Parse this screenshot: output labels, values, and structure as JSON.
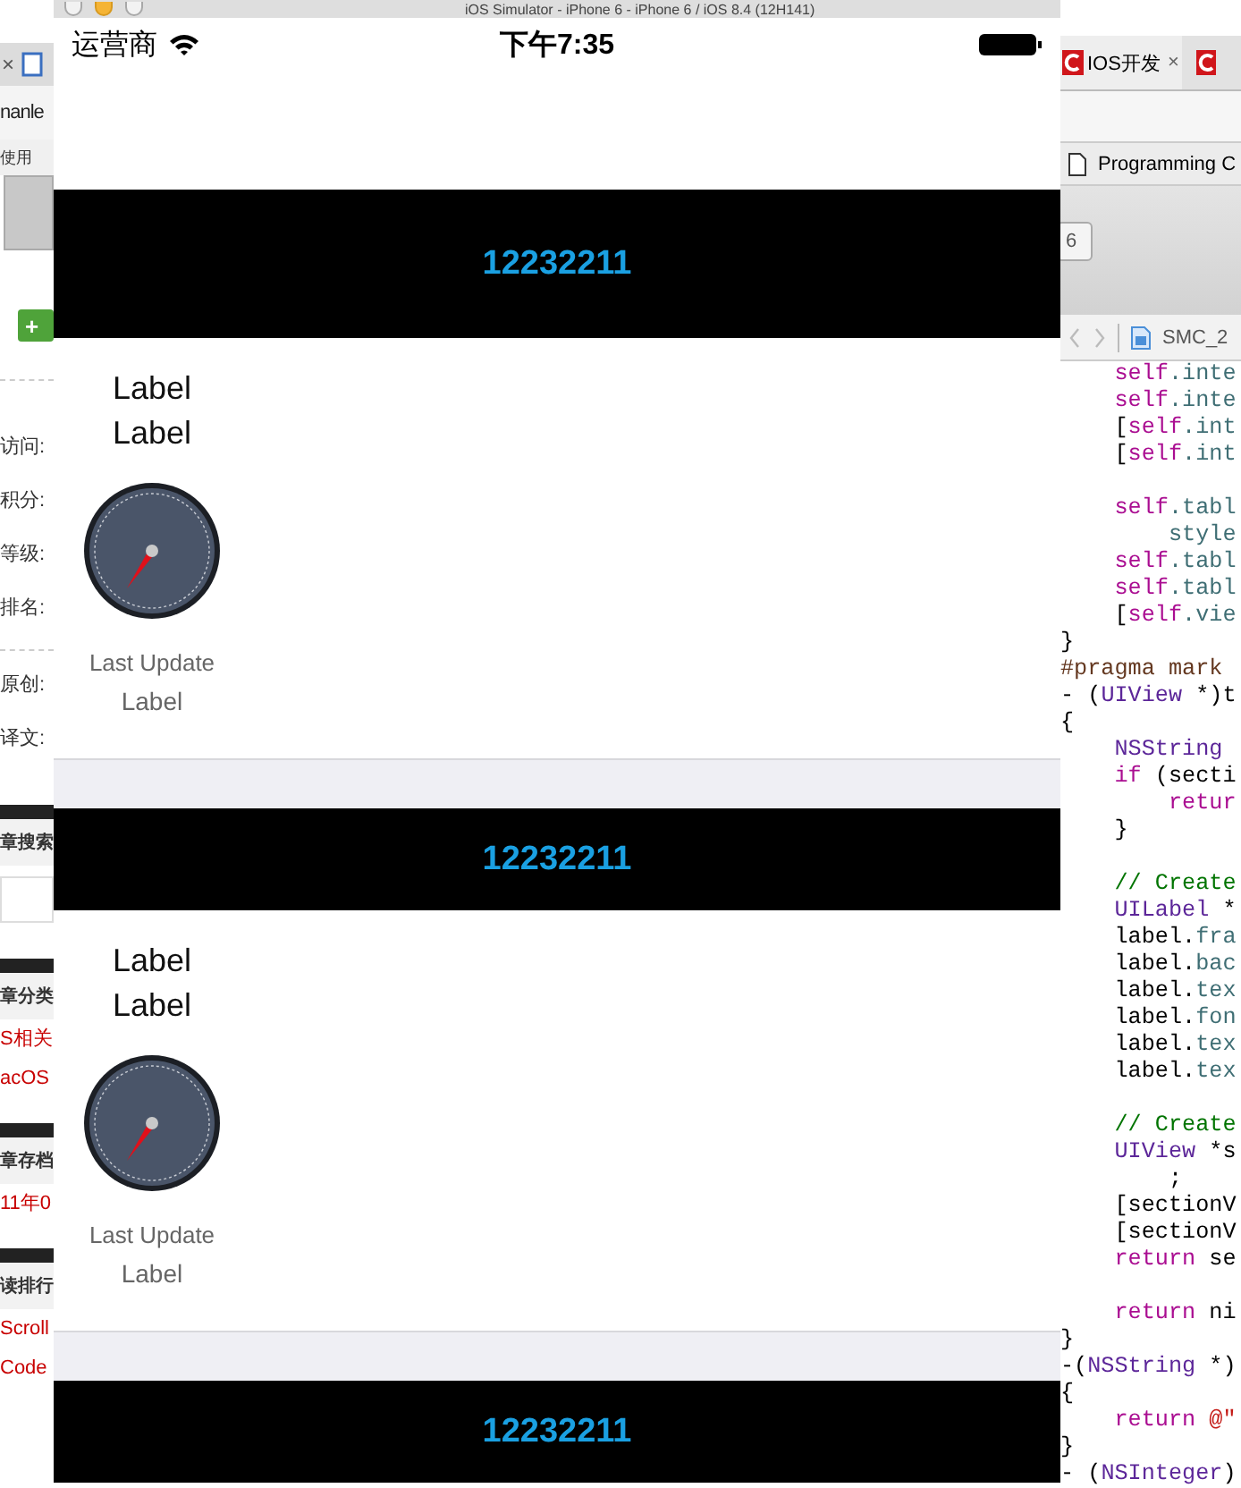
{
  "left_window": {
    "tab_close": "×",
    "address": "nanle",
    "bookmark": "使用",
    "add_button": "+",
    "items": [
      {
        "kind": "stat",
        "text": "访问:"
      },
      {
        "kind": "stat",
        "text": "积分:"
      },
      {
        "kind": "stat",
        "text": "等级:"
      },
      {
        "kind": "stat",
        "text": "排名:"
      },
      {
        "kind": "rule"
      },
      {
        "kind": "stat",
        "text": "原创:"
      },
      {
        "kind": "stat",
        "text": "译文:"
      },
      {
        "kind": "heading",
        "text": "章搜索"
      },
      {
        "kind": "blank"
      },
      {
        "kind": "heading",
        "text": "章分类"
      },
      {
        "kind": "link",
        "text": "S相关"
      },
      {
        "kind": "link",
        "text": "acOS"
      },
      {
        "kind": "heading",
        "text": "章存档"
      },
      {
        "kind": "link",
        "text": "11年0"
      },
      {
        "kind": "heading",
        "text": "读排行"
      },
      {
        "kind": "link",
        "text": "Scroll"
      },
      {
        "kind": "link",
        "text": "Code"
      }
    ]
  },
  "simulator": {
    "title": "iOS Simulator - iPhone 6 - iPhone 6 / iOS 8.4 (12H141)",
    "status_bar": {
      "carrier": "运营商",
      "time": "下午7:35"
    },
    "sections": [
      {
        "title": "12232211",
        "cell": {
          "line1": "Label",
          "line2": "Label",
          "caption": "Last Update",
          "value": "Label"
        }
      },
      {
        "title": "12232211",
        "cell": {
          "line1": "Label",
          "line2": "Label",
          "caption": "Last Update",
          "value": "Label"
        }
      },
      {
        "title": "12232211"
      }
    ]
  },
  "right_window": {
    "tab": {
      "title": "IOS开发",
      "close": "×"
    },
    "bookmark": "Programming C",
    "toolbar_button": "6",
    "jump_bar": "SMC_2",
    "code": [
      {
        "kind": "code",
        "segments": [
          {
            "text": "    self",
            "color": "#aa0d91"
          },
          {
            "text": ".inte",
            "color": "#3f6e74"
          }
        ]
      },
      {
        "kind": "code",
        "segments": [
          {
            "text": "    self",
            "color": "#aa0d91"
          },
          {
            "text": ".inte",
            "color": "#3f6e74"
          }
        ]
      },
      {
        "kind": "code",
        "segments": [
          {
            "text": "    ["
          },
          {
            "text": "self",
            "color": "#aa0d91"
          },
          {
            "text": ".int",
            "color": "#3f6e74"
          }
        ]
      },
      {
        "kind": "code",
        "segments": [
          {
            "text": "    ["
          },
          {
            "text": "self",
            "color": "#aa0d91"
          },
          {
            "text": ".int",
            "color": "#3f6e74"
          }
        ]
      },
      {
        "kind": "blank"
      },
      {
        "kind": "code",
        "segments": [
          {
            "text": "    self",
            "color": "#aa0d91"
          },
          {
            "text": ".tabl",
            "color": "#3f6e74"
          }
        ]
      },
      {
        "kind": "code",
        "segments": [
          {
            "text": "        style",
            "color": "#3f6e74"
          }
        ]
      },
      {
        "kind": "code",
        "segments": [
          {
            "text": "    self",
            "color": "#aa0d91"
          },
          {
            "text": ".tabl",
            "color": "#3f6e74"
          }
        ]
      },
      {
        "kind": "code",
        "segments": [
          {
            "text": "    self",
            "color": "#aa0d91"
          },
          {
            "text": ".tabl",
            "color": "#3f6e74"
          }
        ]
      },
      {
        "kind": "code",
        "segments": [
          {
            "text": "    ["
          },
          {
            "text": "self",
            "color": "#aa0d91"
          },
          {
            "text": ".vie",
            "color": "#3f6e74"
          }
        ]
      },
      {
        "kind": "code",
        "segments": [
          {
            "text": "}"
          }
        ]
      },
      {
        "kind": "code",
        "segments": [
          {
            "text": "#pragma mark",
            "color": "#643820"
          }
        ]
      },
      {
        "kind": "code",
        "segments": [
          {
            "text": "- ("
          },
          {
            "text": "UIView",
            "color": "#5c2699"
          },
          {
            "text": " *)t"
          }
        ]
      },
      {
        "kind": "code",
        "segments": [
          {
            "text": "{"
          }
        ]
      },
      {
        "kind": "code",
        "segments": [
          {
            "text": "    NSString ",
            "color": "#5c2699"
          }
        ]
      },
      {
        "kind": "code",
        "segments": [
          {
            "text": "    if",
            "color": "#aa0d91"
          },
          {
            "text": " (secti"
          }
        ]
      },
      {
        "kind": "code",
        "segments": [
          {
            "text": "        retur",
            "color": "#aa0d91"
          }
        ]
      },
      {
        "kind": "code",
        "segments": [
          {
            "text": "    }"
          }
        ]
      },
      {
        "kind": "blank"
      },
      {
        "kind": "code",
        "segments": [
          {
            "text": "    // Create",
            "color": "#007400"
          }
        ]
      },
      {
        "kind": "code",
        "segments": [
          {
            "text": "    UILabel",
            "color": "#5c2699"
          },
          {
            "text": " *"
          }
        ]
      },
      {
        "kind": "code",
        "segments": [
          {
            "text": "    label."
          },
          {
            "text": "fra",
            "color": "#3f6e74"
          }
        ]
      },
      {
        "kind": "code",
        "segments": [
          {
            "text": "    label."
          },
          {
            "text": "bac",
            "color": "#3f6e74"
          }
        ]
      },
      {
        "kind": "code",
        "segments": [
          {
            "text": "    label."
          },
          {
            "text": "tex",
            "color": "#3f6e74"
          }
        ]
      },
      {
        "kind": "code",
        "segments": [
          {
            "text": "    label."
          },
          {
            "text": "fon",
            "color": "#3f6e74"
          }
        ]
      },
      {
        "kind": "code",
        "segments": [
          {
            "text": "    label."
          },
          {
            "text": "tex",
            "color": "#3f6e74"
          }
        ]
      },
      {
        "kind": "code",
        "segments": [
          {
            "text": "    label."
          },
          {
            "text": "tex",
            "color": "#3f6e74"
          }
        ]
      },
      {
        "kind": "blank"
      },
      {
        "kind": "code",
        "segments": [
          {
            "text": "    // Create",
            "color": "#007400"
          }
        ]
      },
      {
        "kind": "code",
        "segments": [
          {
            "text": "    UIView",
            "color": "#5c2699"
          },
          {
            "text": " *s"
          }
        ]
      },
      {
        "kind": "code",
        "segments": [
          {
            "text": "        ;"
          }
        ]
      },
      {
        "kind": "code",
        "segments": [
          {
            "text": "    [sectionV"
          }
        ]
      },
      {
        "kind": "code",
        "segments": [
          {
            "text": "    [sectionV"
          }
        ]
      },
      {
        "kind": "code",
        "segments": [
          {
            "text": "    return",
            "color": "#aa0d91"
          },
          {
            "text": " se"
          }
        ]
      },
      {
        "kind": "blank"
      },
      {
        "kind": "code",
        "segments": [
          {
            "text": "    return",
            "color": "#aa0d91"
          },
          {
            "text": " ni"
          }
        ]
      },
      {
        "kind": "code",
        "segments": [
          {
            "text": "}"
          }
        ]
      },
      {
        "kind": "code",
        "segments": [
          {
            "text": "-("
          },
          {
            "text": "NSString",
            "color": "#5c2699"
          },
          {
            "text": " *)"
          }
        ]
      },
      {
        "kind": "code",
        "segments": [
          {
            "text": "{"
          }
        ]
      },
      {
        "kind": "code",
        "segments": [
          {
            "text": "    return",
            "color": "#aa0d91"
          },
          {
            "text": " @\"",
            "color": "#c41a16"
          }
        ]
      },
      {
        "kind": "code",
        "segments": [
          {
            "text": "}"
          }
        ]
      },
      {
        "kind": "code",
        "segments": [
          {
            "text": "- ("
          },
          {
            "text": "NSInteger",
            "color": "#5c2699"
          },
          {
            "text": ")"
          }
        ]
      }
    ]
  }
}
